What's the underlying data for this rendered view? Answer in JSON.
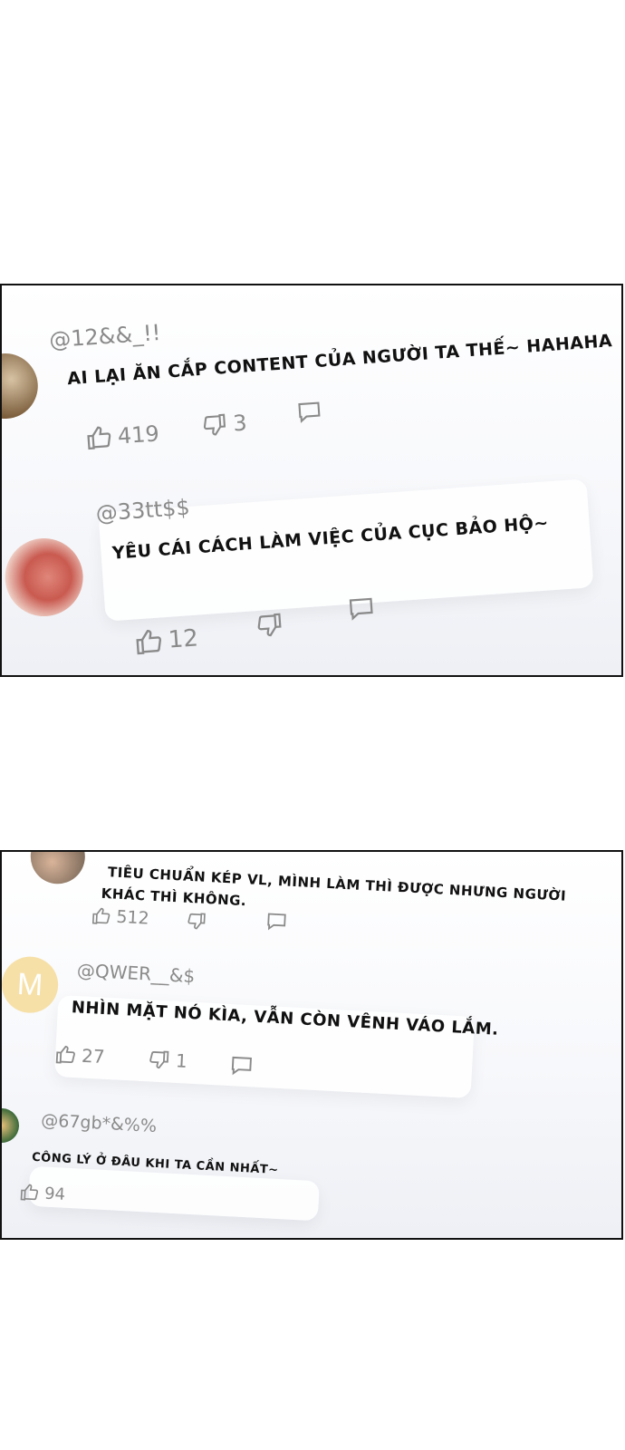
{
  "panel1": {
    "comments": [
      {
        "handle": "@12&&_!!",
        "text": "AI LẠI ĂN CẮP CONTENT CỦA NGƯỜI TA THẾ~ HAHAHA",
        "likes": "419",
        "dislikes": "3"
      },
      {
        "handle": "@33tt$$",
        "text": "YÊU CÁI CÁCH LÀM VIỆC CỦA CỤC BẢO HỘ~",
        "likes": "12",
        "dislikes": ""
      }
    ]
  },
  "panel2": {
    "comments": [
      {
        "handle": "",
        "text_line1": "TIÊU CHUẨN KÉP VL, MÌNH LÀM THÌ ĐƯỢC NHƯNG NGƯỜI",
        "text_line2": "KHÁC THÌ KHÔNG.",
        "likes": "512",
        "dislikes": ""
      },
      {
        "handle": "@QWER__&$",
        "avatar_letter": "M",
        "text": "NHÌN MẶT NÓ KÌA, VẪN CÒN VÊNH VÁO LẮM.",
        "likes": "27",
        "dislikes": "1"
      },
      {
        "handle": "@67gb*&%%",
        "text": "CÔNG LÝ Ở ĐÂU KHI TA CẦN NHẤT~",
        "likes": "94",
        "dislikes": ""
      }
    ]
  },
  "colors": {
    "accent_avatar_m": "#f6e0a8",
    "muted": "#8a8a8a",
    "border": "#111111"
  }
}
